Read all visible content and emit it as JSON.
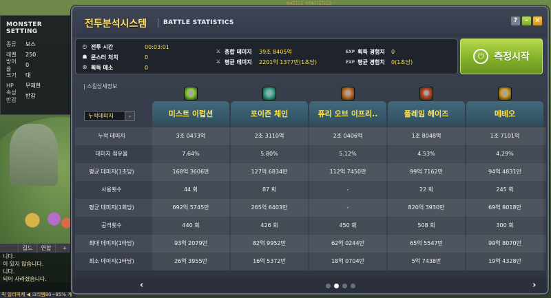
{
  "top_banner": "BATTLE STATISTICS",
  "monster_setting": {
    "title": "MONSTER SETTING",
    "rows": [
      {
        "key": "종류",
        "value": "보스"
      },
      {
        "key": "레벨",
        "value": "250"
      },
      {
        "key": "방어율",
        "value": "0"
      },
      {
        "key": "크기",
        "value": "대"
      },
      {
        "key": "HP",
        "value": "무제한"
      },
      {
        "key": "속성 반감",
        "value": "반감"
      }
    ]
  },
  "chat": {
    "tabs": [
      "",
      "길드",
      "연합",
      "+"
    ],
    "lines": [
      "니다.",
      "이 있지 않습니다.",
      "니다.",
      "되어 사라졌습니다."
    ],
    "status": "퀵 일리피케 ◀ 크리템80~85% 계"
  },
  "window": {
    "title": "전투분석시스템",
    "subtitle": "BATTLE STATISTICS",
    "controls": {
      "help": "?",
      "minimize": "–",
      "close": "×"
    }
  },
  "summary": {
    "battle_time_label": "전투 시간",
    "battle_time": "00:03:01",
    "monsters_killed_label": "몬스터 처치",
    "monsters_killed": "0",
    "meso_label": "획득 메소",
    "meso": "0",
    "total_damage_label": "총합 데미지",
    "total_damage": "39조 8405억",
    "avg_damage_label": "평균 데미지",
    "avg_damage": "2201억 1377만(1초당)",
    "exp_tag": "EXP",
    "exp_gain_label": "획득 경험치",
    "exp_gain": "0",
    "avg_exp_label": "평균 경험치",
    "avg_exp": "0(1초당)"
  },
  "measure_button": "측정시작",
  "section_label": "| 스킬상세정보",
  "dropdown_value": "누적데미지",
  "skills": [
    {
      "name": "미스트 이럽션",
      "icon": "mist-eruption-icon",
      "color": "#8fd23a"
    },
    {
      "name": "포이즌 체인",
      "icon": "poison-chain-icon",
      "color": "#3fb8a4"
    },
    {
      "name": "퓨리 오브 이프리..",
      "icon": "fury-of-ifrit-icon",
      "color": "#d9772a"
    },
    {
      "name": "플레임 헤이즈",
      "icon": "flame-haze-icon",
      "color": "#c9472a"
    },
    {
      "name": "메테오",
      "icon": "meteor-icon",
      "color": "#e2a12a"
    }
  ],
  "rows": [
    {
      "label": "누적 데미지",
      "values": [
        "3조 0473억",
        "2조 3110억",
        "2조 0406억",
        "1조 8048억",
        "1조 7101억"
      ]
    },
    {
      "label": "데미지 점유율",
      "values": [
        "7.64%",
        "5.80%",
        "5.12%",
        "4.53%",
        "4.29%"
      ]
    },
    {
      "label": "평균 데미지(1초당)",
      "values": [
        "168억 3606만",
        "127억 6834만",
        "112억 7450만",
        "99억 7162만",
        "94억 4831만"
      ]
    },
    {
      "label": "사용횟수",
      "values": [
        "44 회",
        "87 회",
        "-",
        "22 회",
        "245 회"
      ]
    },
    {
      "label": "평균 데미지(1회당)",
      "values": [
        "692억 5745만",
        "265억 6403만",
        "-",
        "820억 3930만",
        "69억 8018만"
      ]
    },
    {
      "label": "공격횟수",
      "values": [
        "440 회",
        "426 회",
        "450 회",
        "508 회",
        "300 회"
      ]
    },
    {
      "label": "최대 데미지(1타당)",
      "values": [
        "93억 2079만",
        "82억 9952만",
        "62억 0244만",
        "65억 5547만",
        "99억 8070만"
      ]
    },
    {
      "label": "최소 데미지(1타당)",
      "values": [
        "26억 3955만",
        "16억 5372만",
        "18억 0704만",
        "5억 7438만",
        "19억 4328만"
      ]
    }
  ],
  "pagination": {
    "prev": "‹",
    "next": "›",
    "pages": 4,
    "active": 1
  }
}
